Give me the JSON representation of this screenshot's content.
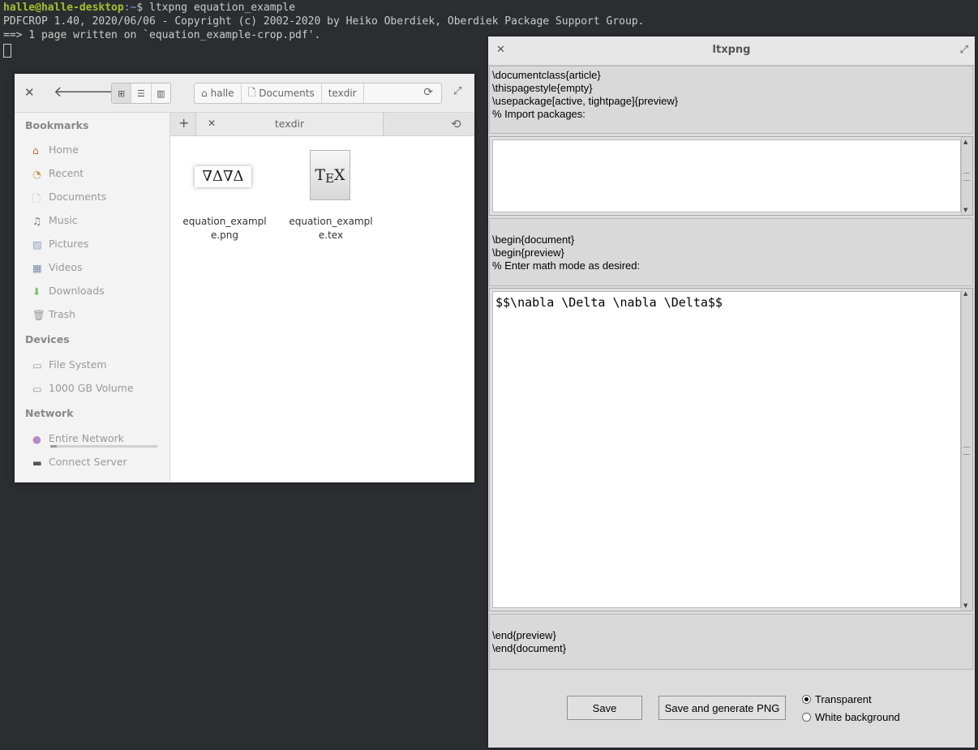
{
  "terminal": {
    "user_host": "halle@halle-desktop",
    "path": ":~",
    "prompt_symbol": "$ ",
    "command": "ltxpng equation_example",
    "line2": "PDFCROP 1.40, 2020/06/06 - Copyright (c) 2002-2020 by Heiko Oberdiek, Oberdiek Package Support Group.",
    "line3": "==> 1 page written on `equation_example-crop.pdf'."
  },
  "file_manager": {
    "breadcrumbs": [
      "halle",
      "Documents",
      "texdir"
    ],
    "tab_label": "texdir",
    "sidebar": {
      "bookmarks_title": "Bookmarks",
      "bookmarks": [
        {
          "label": "Home",
          "icon": "home-icon"
        },
        {
          "label": "Recent",
          "icon": "recent-icon"
        },
        {
          "label": "Documents",
          "icon": "documents-icon"
        },
        {
          "label": "Music",
          "icon": "music-icon"
        },
        {
          "label": "Pictures",
          "icon": "pictures-icon"
        },
        {
          "label": "Videos",
          "icon": "videos-icon"
        },
        {
          "label": "Downloads",
          "icon": "downloads-icon"
        },
        {
          "label": "Trash",
          "icon": "trash-icon"
        }
      ],
      "devices_title": "Devices",
      "devices": [
        {
          "label": "File System",
          "icon": "drive-icon"
        },
        {
          "label": "1000 GB Volume",
          "icon": "drive-icon"
        }
      ],
      "network_title": "Network",
      "network": [
        {
          "label": "Entire Network",
          "icon": "network-icon"
        },
        {
          "label": "Connect Server",
          "icon": "server-icon"
        }
      ]
    },
    "files": [
      {
        "name_line1": "equation_exampl",
        "name_line2": "e.png",
        "thumb": "∇Δ∇Δ"
      },
      {
        "name_line1": "equation_exampl",
        "name_line2": "e.tex",
        "thumb": "TEX"
      }
    ]
  },
  "ltxpng": {
    "title": "ltxpng",
    "preamble": [
      "\\documentclass{article}",
      "\\thispagestyle{empty}",
      "\\usepackage[active, tightpage]{preview}",
      "% Import packages:"
    ],
    "packages_text": "",
    "begin": [
      "\\begin{document}",
      "\\begin{preview}",
      "% Enter math mode as desired:"
    ],
    "math_text": "$$\\nabla \\Delta \\nabla \\Delta$$",
    "end": [
      "\\end{preview}",
      "\\end{document}"
    ],
    "save_label": "Save",
    "save_png_label": "Save and generate PNG",
    "radio_transparent": "Transparent",
    "radio_white": "White background",
    "selected_background": "Transparent"
  }
}
